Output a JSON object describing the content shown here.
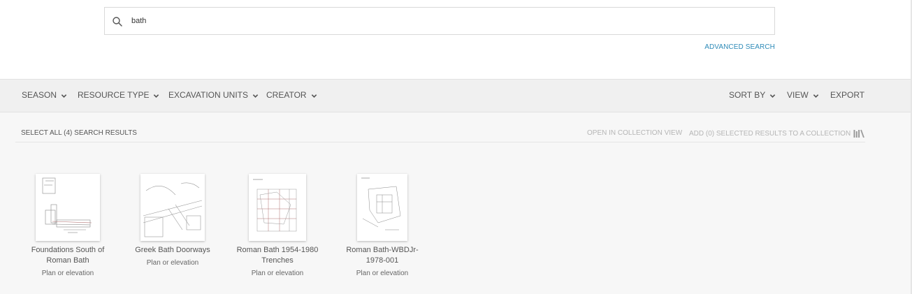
{
  "search": {
    "value": "bath",
    "advanced_label": "ADVANCED SEARCH"
  },
  "filters": {
    "left": [
      "SEASON",
      "RESOURCE TYPE",
      "EXCAVATION UNITS",
      "CREATOR"
    ],
    "sort_by": "SORT BY",
    "view": "VIEW",
    "export": "EXPORT"
  },
  "results_bar": {
    "select_all": "SELECT ALL (4) SEARCH RESULTS",
    "open_collection": "OPEN IN COLLECTION VIEW",
    "add_collection": "ADD (0) SELECTED RESULTS TO A COLLECTION"
  },
  "results": [
    {
      "title_line1": "Foundations South of",
      "title_line2": "Roman Bath",
      "type": "Plan or elevation"
    },
    {
      "title_line1": "Greek Bath Doorways",
      "title_line2": "",
      "type": "Plan or elevation"
    },
    {
      "title_line1": "Roman Bath 1954-1980",
      "title_line2": "Trenches",
      "type": "Plan or elevation"
    },
    {
      "title_line1": "Roman Bath-WBDJr-",
      "title_line2": "1978-001",
      "type": "Plan or elevation"
    }
  ],
  "colors": {
    "accent_link": "#2e8bb8",
    "filter_bar_bg": "#f0f0f0",
    "results_bg": "#f7f7f7"
  },
  "icons": [
    "search-icon",
    "chevron-down-icon",
    "library-icon"
  ]
}
